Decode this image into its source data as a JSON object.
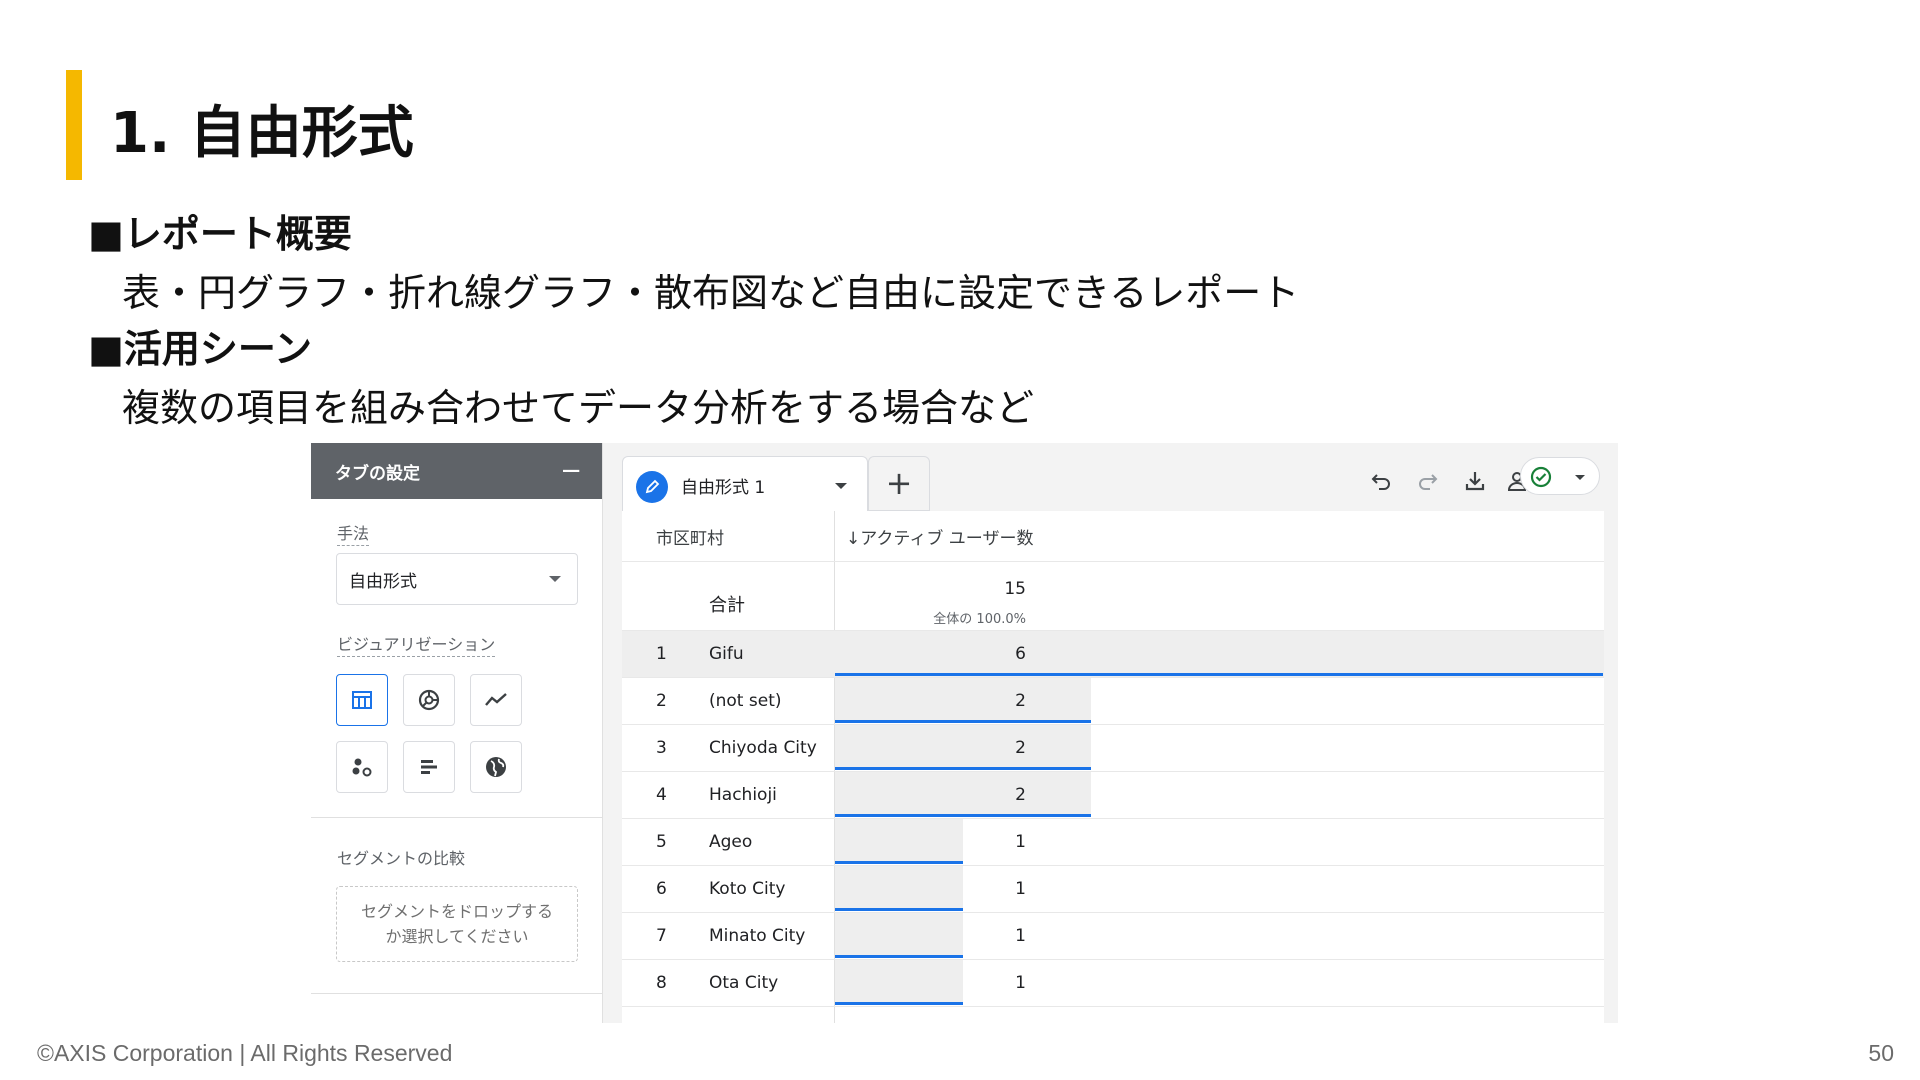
{
  "slide": {
    "title": "1. 自由形式",
    "sections": [
      {
        "heading": "■レポート概要",
        "body": "表・円グラフ・折れ線グラフ・散布図など自由に設定できるレポート"
      },
      {
        "heading": "■活用シーン",
        "body": "複数の項目を組み合わせてデータ分析をする場合など"
      }
    ],
    "footer": {
      "copyright": "©AXIS Corporation | All Rights Reserved",
      "page_number": "50"
    }
  },
  "tab_settings": {
    "header": "タブの設定",
    "collapse_symbol": "−",
    "method_label": "手法",
    "method_value": "自由形式",
    "visualization_label": "ビジュアリゼーション",
    "visualizations": [
      "table-icon",
      "donut-chart-icon",
      "line-chart-icon",
      "scatter-chart-icon",
      "bar-chart-icon",
      "globe-icon"
    ],
    "selected_visualization": "table-icon",
    "segment_label": "セグメントの比較",
    "segment_drop_line1": "セグメントをドロップする",
    "segment_drop_line2": "か選択してください"
  },
  "report": {
    "tab_label": "自由形式 1",
    "add_tab": "+",
    "toolbar_icons": [
      "undo-icon",
      "redo-icon",
      "download-icon",
      "share-user-icon",
      "check-circle-icon"
    ],
    "accent_color": "#1a73e8",
    "columns": [
      "市区町村",
      "↓アクティブ ユーザー数"
    ],
    "total_label": "合計",
    "total_value": "15",
    "total_sub": "全体の 100.0%",
    "rows": [
      {
        "index": "1",
        "city": "Gifu",
        "value": "6",
        "share": 1.0
      },
      {
        "index": "2",
        "city": "(not set)",
        "value": "2",
        "share": 0.3333
      },
      {
        "index": "3",
        "city": "Chiyoda City",
        "value": "2",
        "share": 0.3333
      },
      {
        "index": "4",
        "city": "Hachioji",
        "value": "2",
        "share": 0.3333
      },
      {
        "index": "5",
        "city": "Ageo",
        "value": "1",
        "share": 0.1667
      },
      {
        "index": "6",
        "city": "Koto City",
        "value": "1",
        "share": 0.1667
      },
      {
        "index": "7",
        "city": "Minato City",
        "value": "1",
        "share": 0.1667
      },
      {
        "index": "8",
        "city": "Ota City",
        "value": "1",
        "share": 0.1667
      }
    ]
  }
}
